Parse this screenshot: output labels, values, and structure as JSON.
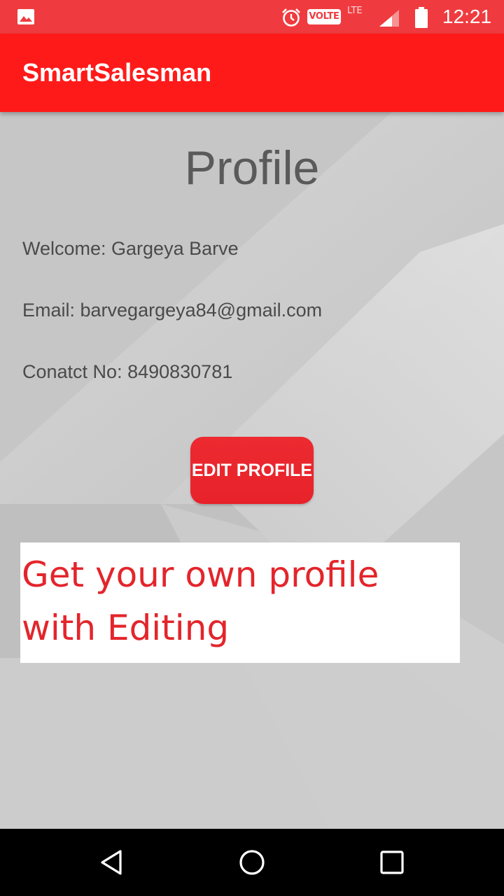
{
  "status_bar": {
    "volte_label": "VOLTE",
    "lte_label": "LTE",
    "time": "12:21",
    "icons": [
      "image-icon",
      "alarm-icon",
      "signal-icon",
      "battery-icon"
    ]
  },
  "app_bar": {
    "title": "SmartSalesman"
  },
  "profile": {
    "heading": "Profile",
    "welcome": "Welcome: Gargeya Barve",
    "email": "Email: barvegargeya84@gmail.com",
    "contact": "Conatct No: 8490830781",
    "edit_button_label": "EDIT PROFILE"
  },
  "promo": {
    "line1": "Get your own profile",
    "line2": "with Editing"
  },
  "navigation": {
    "icons": [
      "back-icon",
      "home-icon",
      "recents-icon"
    ]
  },
  "colors": {
    "status_bar": "#ef3b3f",
    "app_bar": "#ff1a1a",
    "accent": "#e8222a",
    "promo_text": "#e3252b",
    "nav_bar": "#000000"
  }
}
